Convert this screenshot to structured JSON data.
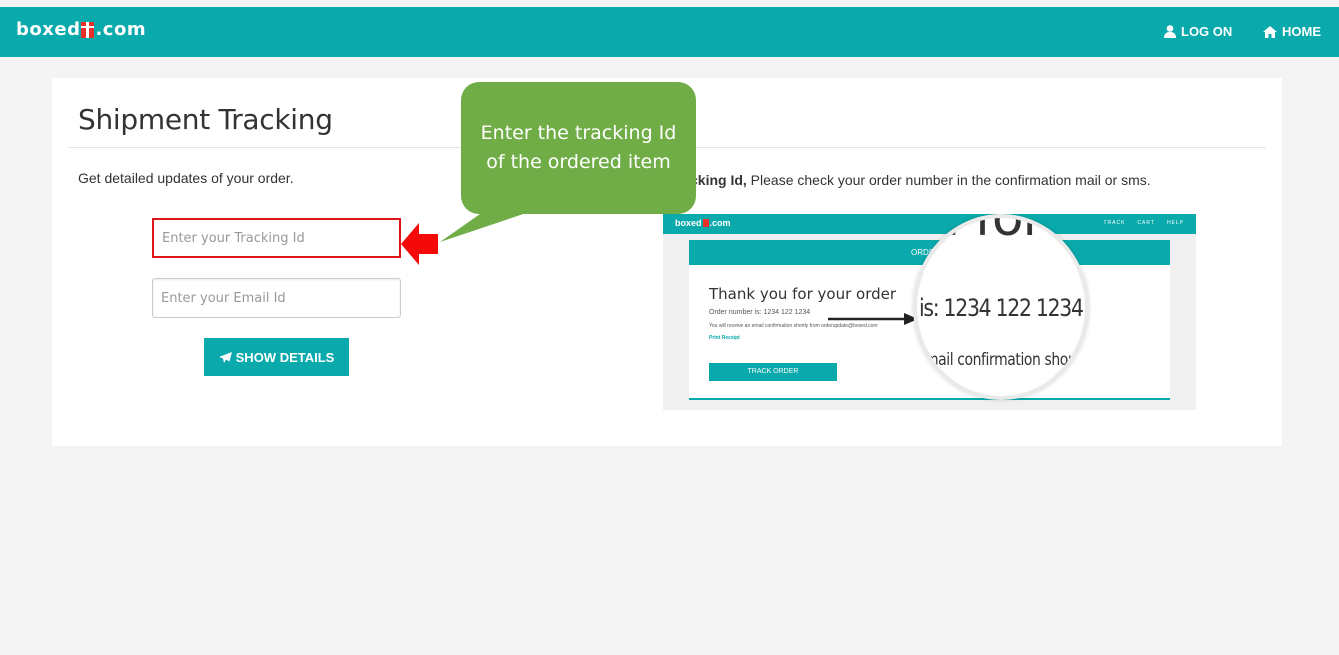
{
  "header": {
    "brand_prefix": "boxed",
    "brand_suffix": ".com",
    "login_label": "LOG ON",
    "home_label": "HOME",
    "color": "#0aa9ab"
  },
  "main": {
    "title": "Shipment Tracking",
    "subtitle": "Get detailed updates of your order.",
    "hint_bold": "cking Id,",
    "hint_text": " Please check your order number in the confirmation mail or sms.",
    "tracking_placeholder": "Enter your Tracking Id",
    "email_placeholder": "Enter your Email Id",
    "show_details_label": "SHOW DETAILS"
  },
  "callout": {
    "line1": "Enter the tracking Id",
    "line2": "of the ordered item",
    "color": "#70ad47"
  },
  "preview": {
    "brand_prefix": "boxed",
    "brand_suffix": ".com",
    "nav_track": "TRACK",
    "nav_cart": "CART",
    "nav_help": "HELP",
    "bar_label": "ORDER D",
    "thanks": "Thank you for your order",
    "order_number": "Order number is: 1234 122 1234",
    "mail_note": "You will receive an email confirmation shortly from orderupdate@boxed.com",
    "print_receipt": "Print Receipt",
    "track_button": "TRACK ORDER",
    "mag_top": "d for yo",
    "mag_mid": "is: 1234 122 1234",
    "mag_bot": "mail confirmation shortly f"
  },
  "icons": {
    "login": "user-icon",
    "home": "home-icon",
    "send": "paper-plane-icon"
  }
}
